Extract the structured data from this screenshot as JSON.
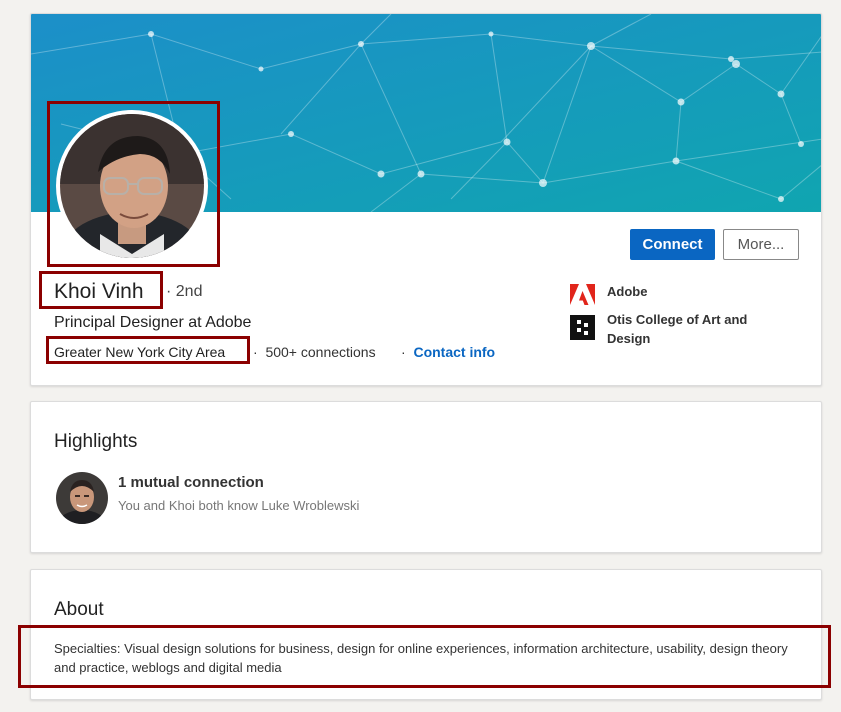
{
  "profile": {
    "name": "Khoi Vinh",
    "degree": "2nd",
    "headline": "Principal Designer at Adobe",
    "location": "Greater New York City Area",
    "connections": "500+ connections",
    "contact_info": "Contact info",
    "separator": "·"
  },
  "actions": {
    "connect_label": "Connect",
    "more_label": "More..."
  },
  "experience": [
    {
      "label": "Adobe",
      "icon": "adobe-logo-icon"
    },
    {
      "label": "Otis College of Art and Design",
      "icon": "otis-logo-icon"
    }
  ],
  "highlights": {
    "title": "Highlights",
    "mutual_title": "1 mutual connection",
    "mutual_sub": "You and Khoi both know Luke Wroblewski"
  },
  "about": {
    "title": "About",
    "text": "Specialties: Visual design solutions for business, design for online experiences, information architecture, usability, design theory and practice, weblogs and digital media"
  },
  "colors": {
    "primary": "#0a66c2",
    "highlight_box": "#8b0000",
    "adobe_red": "#e1251b"
  }
}
